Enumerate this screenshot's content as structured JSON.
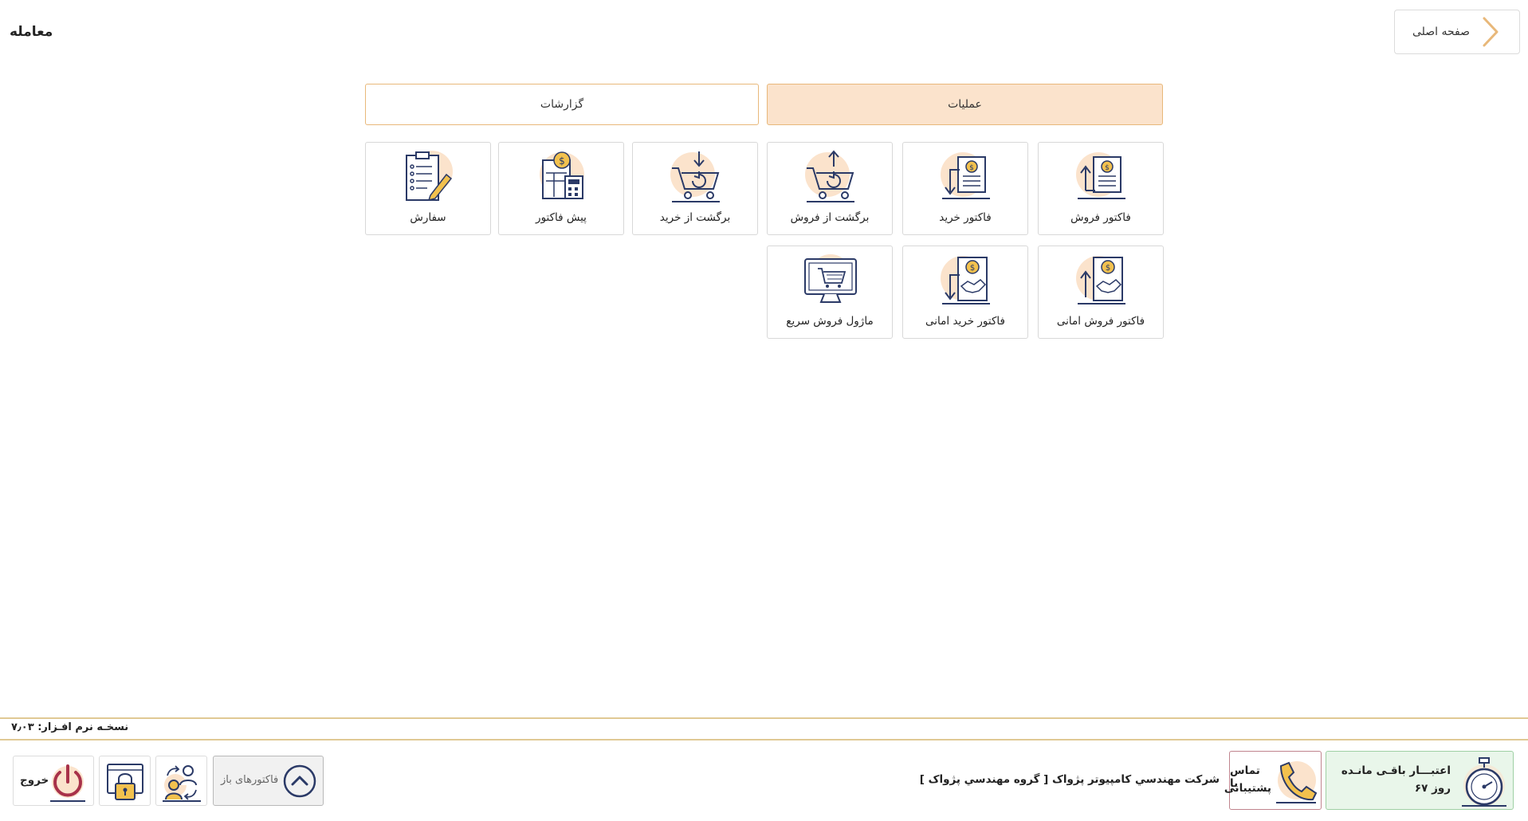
{
  "page": {
    "title": "معامله"
  },
  "nav": {
    "home_label": "صفحه اصلی",
    "home_icon": "chevron-right-icon"
  },
  "tabs": [
    {
      "label": "عملیات",
      "active": true
    },
    {
      "label": "گزارشات",
      "active": false
    }
  ],
  "tiles": [
    {
      "label": "فاکتور فروش",
      "icon": "sales-invoice-icon"
    },
    {
      "label": "فاکتور خرید",
      "icon": "purchase-invoice-icon"
    },
    {
      "label": "برگشت از فروش",
      "icon": "sales-return-icon"
    },
    {
      "label": "برگشت از خرید",
      "icon": "purchase-return-icon"
    },
    {
      "label": "پیش فاکتور",
      "icon": "proforma-invoice-icon"
    },
    {
      "label": "سفارش",
      "icon": "order-clipboard-icon"
    },
    {
      "label": "فاکتور فروش امانی",
      "icon": "consignment-sales-icon"
    },
    {
      "label": "فاکتور خرید امانی",
      "icon": "consignment-purchase-icon"
    },
    {
      "label": "ماژول فروش سریع",
      "icon": "quick-sale-icon"
    }
  ],
  "footer": {
    "version": "نسخـه نرم افـزار: ۷٫۰۳",
    "credit_line1": "اعتبـــار باقـی مانـده",
    "credit_line2": "۶۷ روز",
    "support_line1": "تماس با",
    "support_line2": "پشتیبانی",
    "company": "شرکت مهندسي کامپيوتر پژواک [ گروه مهندسي پژواک ]",
    "open_invoices": "فاکتورهای باز",
    "exit": "خروج"
  },
  "colors": {
    "accent": "#e8b87a",
    "tab_active_bg": "#fbe3cc",
    "icon_stroke": "#2b3a67",
    "icon_highlight": "#fbe3cc",
    "coin": "#f2c14e",
    "credit_bg": "#e9f6ea",
    "support_border": "#c0848e"
  }
}
